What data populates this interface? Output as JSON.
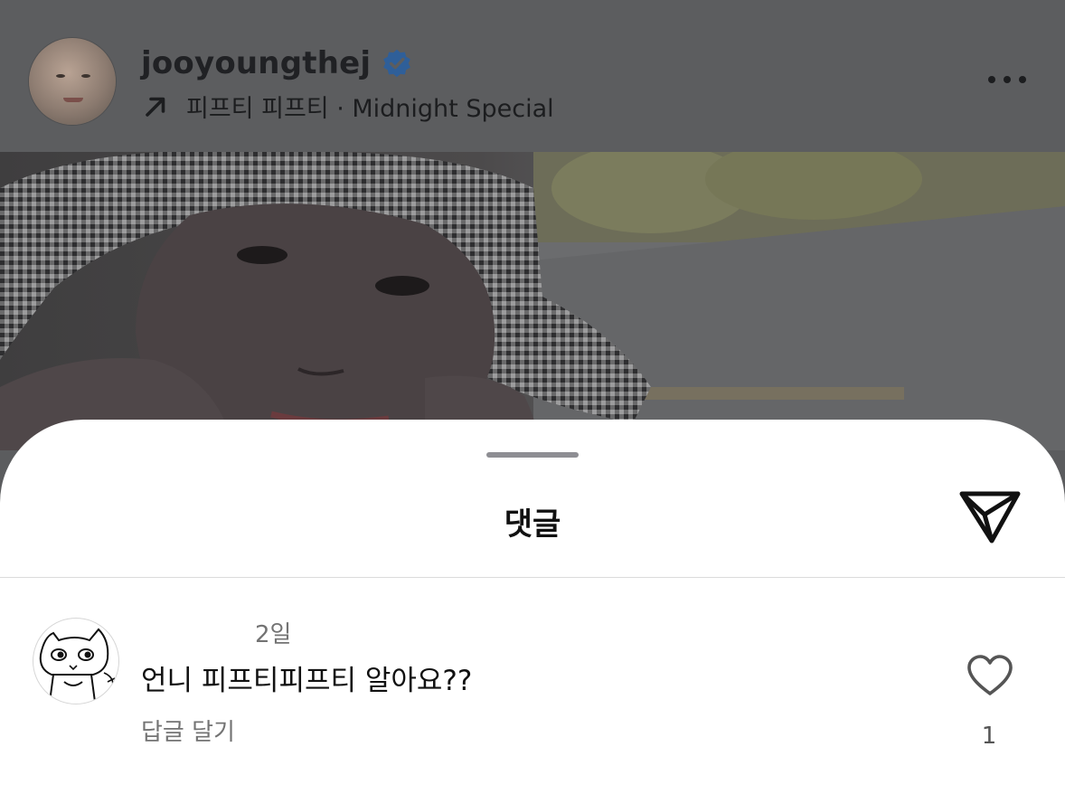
{
  "post": {
    "username": "jooyoungthej",
    "verified_icon": "verified-badge-icon",
    "music_icon": "arrow-up-right-icon",
    "music_text": "피프티 피프티 · Midnight Special",
    "more_icon": "more-horizontal-icon"
  },
  "sheet": {
    "title": "댓글",
    "share_icon": "send-icon"
  },
  "comments": [
    {
      "time": "2일",
      "text": "언니 피프티피프티 알아요??",
      "reply_label": "답글 달기",
      "like_icon": "heart-outline-icon",
      "like_count": "1"
    }
  ],
  "colors": {
    "verified_blue": "#2f6db5",
    "muted_text": "#737373",
    "dimmed_overlay": "#5c5d5f"
  }
}
